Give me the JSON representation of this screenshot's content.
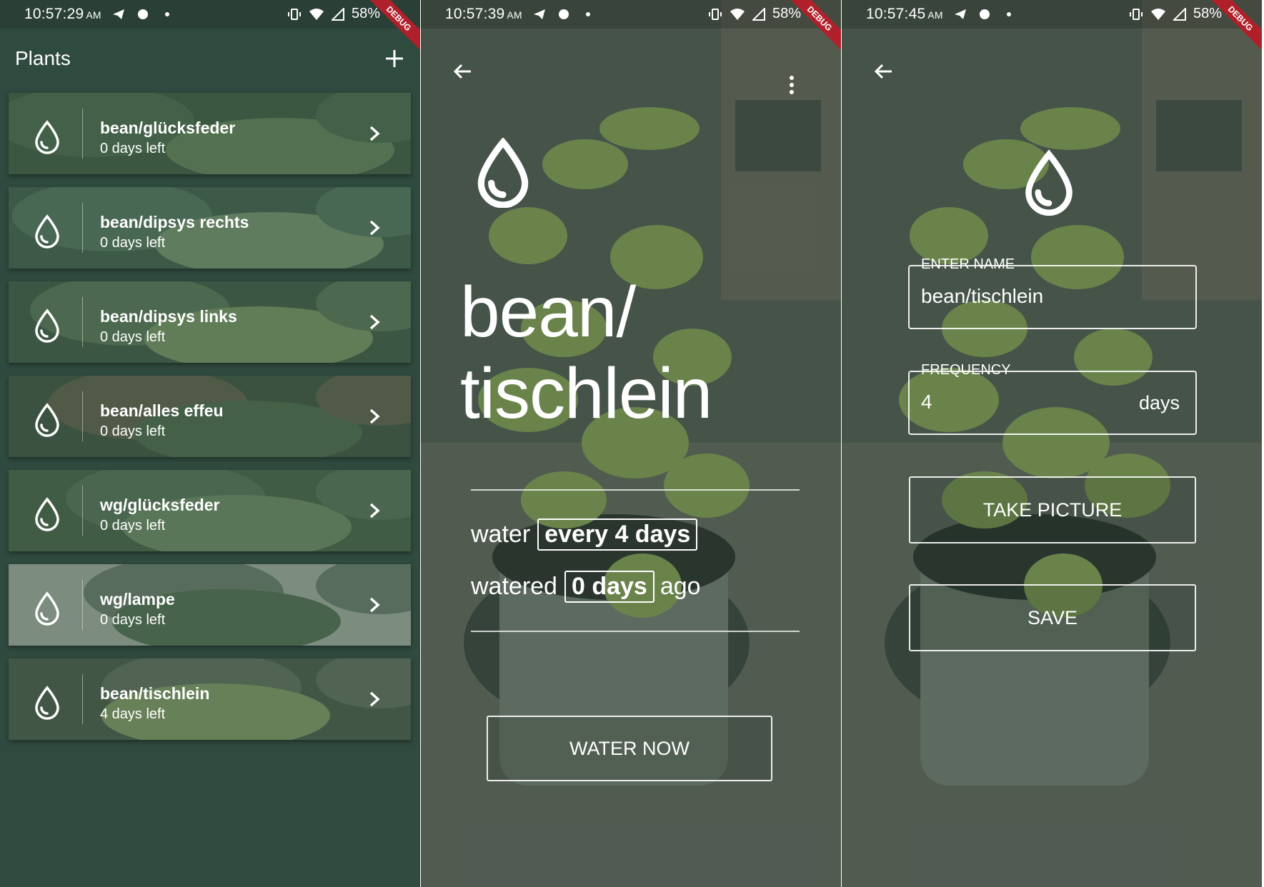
{
  "status_bars": [
    {
      "time": "10:57:29",
      "ampm": "AM",
      "battery": "58%"
    },
    {
      "time": "10:57:39",
      "ampm": "AM",
      "battery": "58%"
    },
    {
      "time": "10:57:45",
      "ampm": "AM",
      "battery": "58%"
    }
  ],
  "debug_label": "DEBUG",
  "list_screen": {
    "title": "Plants",
    "plants": [
      {
        "name": "bean/glücksfeder",
        "days_left": "0 days left"
      },
      {
        "name": "bean/dipsys rechts",
        "days_left": "0 days left"
      },
      {
        "name": "bean/dipsys links",
        "days_left": "0 days left"
      },
      {
        "name": "bean/alles effeu",
        "days_left": "0 days left"
      },
      {
        "name": "wg/glücksfeder",
        "days_left": "0 days left"
      },
      {
        "name": "wg/lampe",
        "days_left": "0 days left"
      },
      {
        "name": "bean/tischlein",
        "days_left": "4 days left"
      }
    ]
  },
  "detail_screen": {
    "title_line1": "bean/",
    "title_line2": "tischlein",
    "water_prefix": "water",
    "water_value": "every 4 days",
    "watered_prefix": "watered",
    "watered_value": "0 days",
    "watered_suffix": "ago",
    "water_now_label": "WATER NOW"
  },
  "edit_screen": {
    "name_label": "ENTER NAME",
    "name_value": "bean/tischlein",
    "frequency_label": "FREQUENCY",
    "frequency_value": "4",
    "frequency_suffix": "days",
    "take_picture_label": "TAKE PICTURE",
    "save_label": "SAVE"
  },
  "colors": {
    "app_background": "#2f4a3f",
    "card_tint": "#3c5a48",
    "debug_ribbon": "#b0202a",
    "foreground": "#ffffff"
  },
  "icons": [
    "water-drop-icon",
    "chevron-right-icon",
    "add-icon",
    "back-arrow-icon",
    "more-vert-icon",
    "telegram-icon",
    "circle-icon",
    "vibrate-icon",
    "wifi-icon",
    "signal-icon"
  ]
}
